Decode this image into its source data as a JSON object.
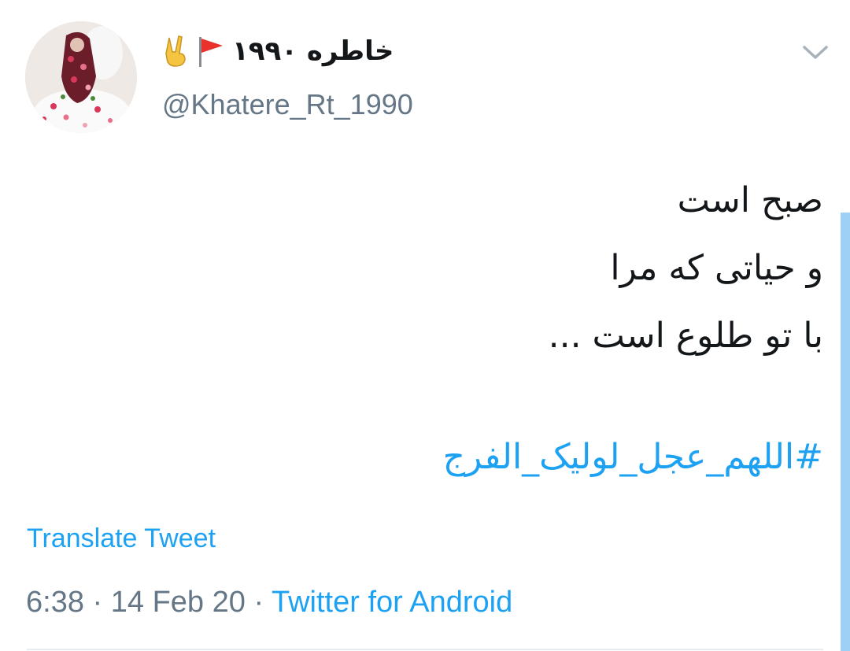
{
  "user": {
    "display_name": "خاطره ۱۹۹۰",
    "flag_emoji": "triangular-flag-icon",
    "hand_emoji": "victory-hand-icon",
    "handle": "@Khatere_Rt_1990"
  },
  "tweet": {
    "lines": [
      "صبح است",
      "و حیاتی که مرا",
      "با تو طلوع است ..."
    ],
    "hashtag": "#اللهم_عجل_لولیک_الفرج"
  },
  "actions": {
    "translate_label": "Translate Tweet",
    "more_icon": "chevron-down-icon"
  },
  "meta": {
    "time": "6:38",
    "separator": " · ",
    "date": "14 Feb 20",
    "source": "Twitter for Android"
  },
  "colors": {
    "link": "#1da1f2",
    "secondary_text": "#657786",
    "primary_text": "#14171a"
  }
}
